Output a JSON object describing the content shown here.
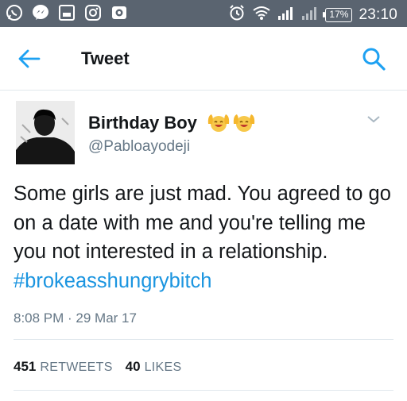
{
  "status_bar": {
    "battery": "17%",
    "time": "23:10",
    "icons": [
      "whatsapp-icon",
      "messenger-icon",
      "gallery-icon",
      "instagram-icon",
      "camera-icon",
      "alarm-icon",
      "wifi-icon",
      "signal-icon",
      "signal-weak-icon",
      "battery-icon"
    ]
  },
  "header": {
    "title": "Tweet",
    "back_icon": "arrow-left-icon",
    "search_icon": "search-icon",
    "accent": "#1da1f2"
  },
  "tweet": {
    "author_name": "Birthday Boy",
    "handle": "@Pabloayodeji",
    "emoji": "smiling-face-with-raised-hands",
    "text_before": "Some girls are just mad. You agreed to go on a date with me and you're telling me you not interested in a relationship. ",
    "hashtag": "#brokeasshungrybitch",
    "timestamp": "8:08 PM · 29 Mar 17",
    "retweets_count": "451",
    "retweets_label": "RETWEETS",
    "likes_count": "40",
    "likes_label": "LIKES",
    "hashtag_color": "#1b95e0"
  }
}
